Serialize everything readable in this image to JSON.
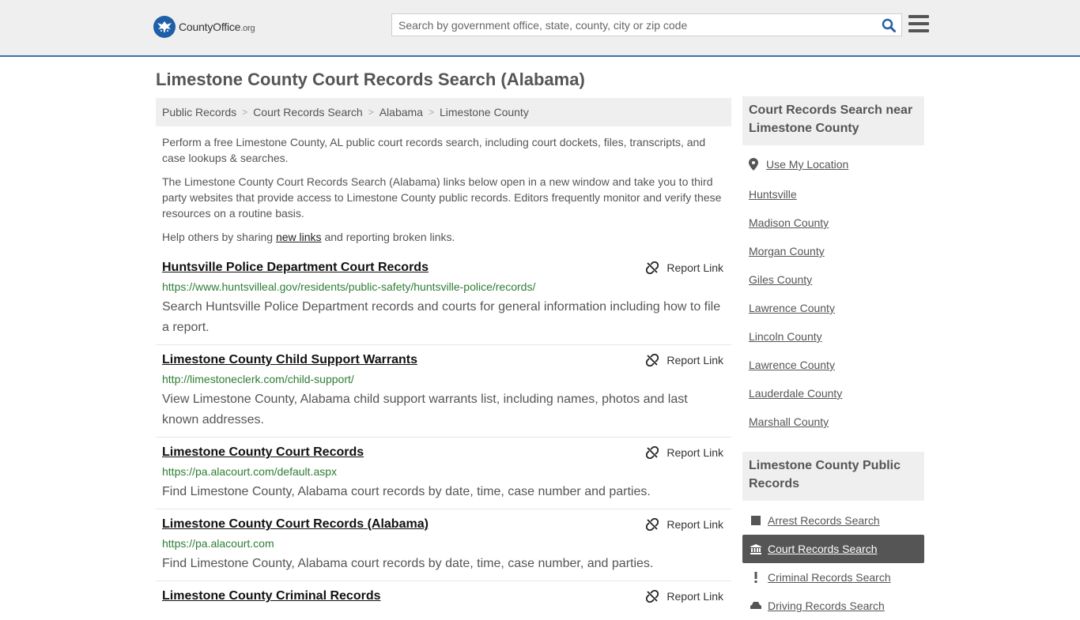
{
  "header": {
    "logo_name": "CountyOffice",
    "logo_suffix": ".org",
    "search_placeholder": "Search by government office, state, county, city or zip code"
  },
  "page": {
    "title": "Limestone County Court Records Search (Alabama)"
  },
  "breadcrumb": [
    "Public Records",
    "Court Records Search",
    "Alabama",
    "Limestone County"
  ],
  "intro": {
    "p1": "Perform a free Limestone County, AL public court records search, including court dockets, files, transcripts, and case lookups & searches.",
    "p2": "The Limestone County Court Records Search (Alabama) links below open in a new window and take you to third party websites that provide access to Limestone County public records. Editors frequently monitor and verify these resources on a routine basis.",
    "p3_before": "Help others by sharing ",
    "p3_link": "new links",
    "p3_after": " and reporting broken links."
  },
  "report_label": "Report Link",
  "listings": [
    {
      "title": "Huntsville Police Department Court Records",
      "url": "https://www.huntsvilleal.gov/residents/public-safety/huntsville-police/records/",
      "desc": "Search Huntsville Police Department records and courts for general information including how to file a report."
    },
    {
      "title": "Limestone County Child Support Warrants",
      "url": "http://limestoneclerk.com/child-support/",
      "desc": "View Limestone County, Alabama child support warrants list, including names, photos and last known addresses."
    },
    {
      "title": "Limestone County Court Records",
      "url": "https://pa.alacourt.com/default.aspx",
      "desc": "Find Limestone County, Alabama court records by date, time, case number and parties."
    },
    {
      "title": "Limestone County Court Records (Alabama)",
      "url": "https://pa.alacourt.com",
      "desc": "Find Limestone County, Alabama court records by date, time, case number, and parties."
    },
    {
      "title": "Limestone County Criminal Records",
      "url": "",
      "desc": ""
    }
  ],
  "sidebar": {
    "nearby_heading": "Court Records Search near Limestone County",
    "use_location": "Use My Location",
    "nearby": [
      "Huntsville",
      "Madison County",
      "Morgan County",
      "Giles County",
      "Lawrence County",
      "Lincoln County",
      "Lawrence County",
      "Lauderdale County",
      "Marshall County"
    ],
    "public_heading": "Limestone County Public Records",
    "public_records": [
      {
        "label": "Arrest Records Search",
        "icon": "square-icon"
      },
      {
        "label": "Court Records Search",
        "icon": "courthouse-icon"
      },
      {
        "label": "Criminal Records Search",
        "icon": "exclamation-icon"
      },
      {
        "label": "Driving Records Search",
        "icon": "car-icon"
      }
    ]
  },
  "colors": {
    "accent": "#3f6ea8",
    "logo_blue": "#1f5fa8",
    "url_green": "#2e7d32",
    "active_bg": "#555555"
  }
}
